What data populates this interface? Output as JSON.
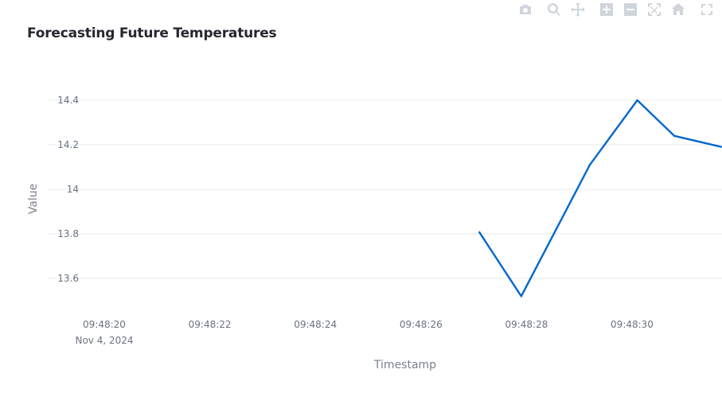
{
  "chart_data": {
    "type": "line",
    "title": "Forecasting Future Temperatures",
    "xlabel": "Timestamp",
    "ylabel": "Value",
    "x_ticks": [
      "09:48:20",
      "09:48:22",
      "09:48:24",
      "09:48:26",
      "09:48:28",
      "09:48:30"
    ],
    "x_tick_date": "Nov 4, 2024",
    "y_ticks": [
      "13.6",
      "13.8",
      "14",
      "14.2",
      "14.4"
    ],
    "ylim": [
      13.45,
      14.5
    ],
    "grid": true,
    "series": [
      {
        "color": "#0068c9",
        "x": [
          "09:48:27.1",
          "09:48:27.9",
          "09:48:29.2",
          "09:48:30.1",
          "09:48:30.8",
          "09:48:31.7"
        ],
        "y": [
          13.81,
          13.52,
          14.11,
          14.4,
          14.24,
          14.19
        ]
      }
    ]
  },
  "modebar": {
    "icons": [
      "camera-icon",
      "zoom-icon",
      "pan-icon",
      "zoom-in-icon",
      "zoom-out-icon",
      "autoscale-icon",
      "home-icon",
      "fullscreen-icon"
    ]
  }
}
